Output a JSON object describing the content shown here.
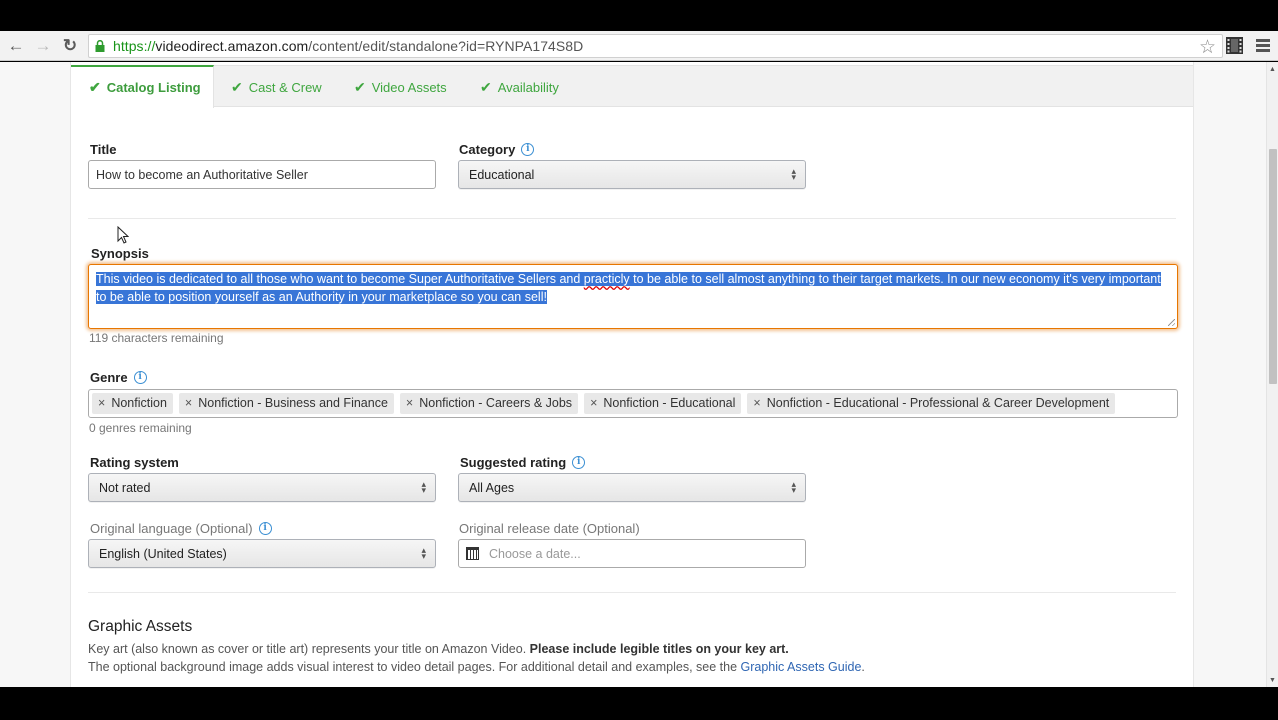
{
  "browser": {
    "url_scheme": "https://",
    "url_host": "videodirect.amazon.com",
    "url_path": "/content/edit/standalone?id=RYNPA174S8D",
    "icons": {
      "back": "back-arrow-icon",
      "forward": "forward-arrow-icon",
      "reload": "reload-icon",
      "lock": "lock-icon",
      "bookmark": "star-icon",
      "extension": "film-strip-icon",
      "menu": "hamburger-menu-icon"
    }
  },
  "tabs": [
    {
      "label": "Catalog Listing",
      "active": true,
      "complete": true
    },
    {
      "label": "Cast & Crew",
      "active": false,
      "complete": true
    },
    {
      "label": "Video Assets",
      "active": false,
      "complete": true
    },
    {
      "label": "Availability",
      "active": false,
      "complete": true
    }
  ],
  "form": {
    "title": {
      "label": "Title",
      "value": "How to become an Authoritative Seller"
    },
    "category": {
      "label": "Category",
      "value": "Educational"
    },
    "synopsis": {
      "label": "Synopsis",
      "value_part1": "This video is dedicated to all those who want to become Super Authoritative Sellers and ",
      "misspelled_word": "practicly",
      "value_part2": " to be able to sell almost anything to their target markets. In our new economy it's very important to be able to position yourself as an Authority in your marketplace so you can sell!",
      "remaining": "119 characters remaining"
    },
    "genre": {
      "label": "Genre",
      "chips": [
        "Nonfiction",
        "Nonfiction - Business and Finance",
        "Nonfiction - Careers & Jobs",
        "Nonfiction - Educational",
        "Nonfiction - Educational - Professional & Career Development"
      ],
      "remaining": "0 genres remaining"
    },
    "rating_system": {
      "label": "Rating system",
      "value": "Not rated"
    },
    "suggested_rating": {
      "label": "Suggested rating",
      "value": "All Ages"
    },
    "original_language": {
      "label": "Original language (Optional)",
      "value": "English (United States)"
    },
    "release_date": {
      "label": "Original release date (Optional)",
      "placeholder": "Choose a date..."
    }
  },
  "graphic_assets": {
    "heading": "Graphic Assets",
    "line1_text": "Key art (also known as cover or title art) represents your title on Amazon Video. ",
    "line1_bold": "Please include legible titles on your key art.",
    "line2_text": "The optional background image adds visual interest to video detail pages. For additional detail and examples, see the ",
    "line2_link": "Graphic Assets Guide",
    "line2_end": "."
  },
  "colors": {
    "accent_green": "#3fa63f",
    "focus_orange": "#e77600",
    "selection_blue": "#3875d7",
    "link_blue": "#2f66b3",
    "info_blue": "#3b8fd3"
  }
}
